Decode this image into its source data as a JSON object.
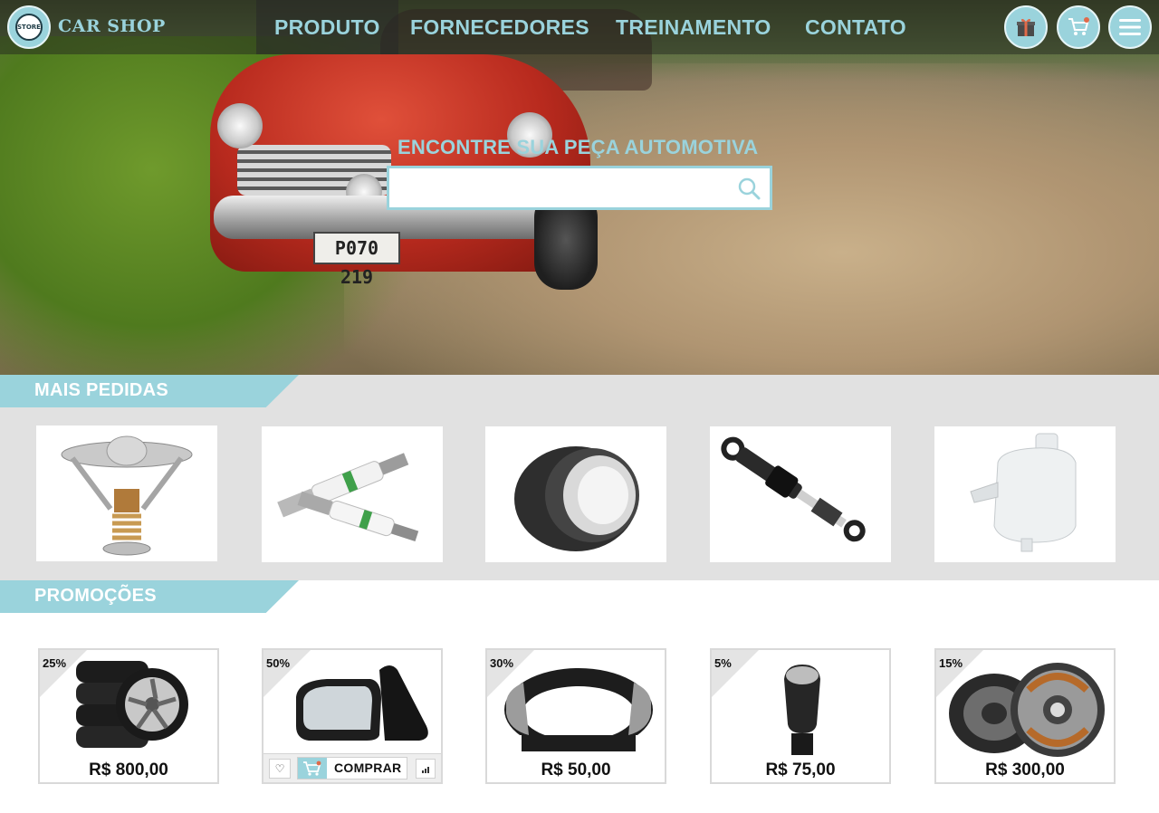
{
  "header": {
    "brand": "CAR SHOP",
    "logo_text": "STORE",
    "nav": [
      {
        "label": "PRODUTO"
      },
      {
        "label": "FORNECEDORES"
      },
      {
        "label": "TREINAMENTO"
      },
      {
        "label": "CONTATO"
      }
    ],
    "icons": [
      "gift-icon",
      "cart-icon",
      "menu-icon"
    ]
  },
  "hero": {
    "plate": "P070 219",
    "search_title": "ENCONTRE SUA PEÇA AUTOMOTIVA",
    "search_value": "",
    "search_placeholder": ""
  },
  "best_sellers": {
    "title": "MAIS PEDIDAS",
    "items": [
      {
        "icon": "thermostat-image"
      },
      {
        "icon": "spark-plug-image"
      },
      {
        "icon": "brake-drum-image"
      },
      {
        "icon": "shock-absorber-image"
      },
      {
        "icon": "coolant-reservoir-image"
      }
    ]
  },
  "promotions": {
    "title": "PROMOÇÕES",
    "items": [
      {
        "discount": "25%",
        "price": "R$ 800,00",
        "icon": "tires-image"
      },
      {
        "discount": "50%",
        "price": "",
        "icon": "side-mirror-image",
        "buy_label": "COMPRAR",
        "heart": "♡"
      },
      {
        "discount": "30%",
        "price": "R$ 50,00",
        "icon": "steering-wheel-cover-image"
      },
      {
        "discount": "5%",
        "price": "R$ 75,00",
        "icon": "gear-knob-image"
      },
      {
        "discount": "15%",
        "price": "R$ 300,00",
        "icon": "drum-brake-kit-image"
      }
    ]
  },
  "colors": {
    "accent": "#9ad3dc",
    "grey_band": "#e1e1e1"
  }
}
